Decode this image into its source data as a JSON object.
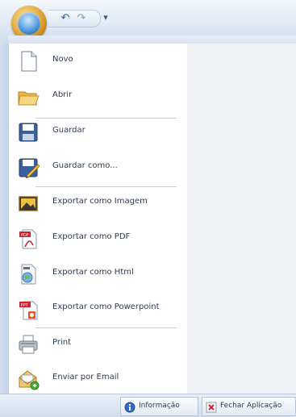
{
  "quick_access": {
    "undo_icon": "undo-icon",
    "redo_icon": "redo-icon",
    "customize_glyph": "▾"
  },
  "menu": {
    "items": [
      {
        "label": "Novo",
        "icon": "new-document-icon"
      },
      {
        "label": "Abrir",
        "icon": "open-folder-icon"
      },
      {
        "label": "Guardar",
        "icon": "save-icon"
      },
      {
        "label": "Guardar como...",
        "icon": "save-as-icon"
      },
      {
        "label": "Exportar como Imagem",
        "icon": "image-export-icon"
      },
      {
        "label": "Exportar como PDF",
        "icon": "pdf-icon"
      },
      {
        "label": "Exportar como Html",
        "icon": "html-icon"
      },
      {
        "label": "Exportar como Powerpoint",
        "icon": "powerpoint-icon"
      },
      {
        "label": "Print",
        "icon": "printer-icon"
      },
      {
        "label": "Enviar por Email",
        "icon": "email-icon"
      }
    ]
  },
  "statusbar": {
    "info_label": "Informação",
    "close_label": "Fechar Aplicação"
  },
  "colors": {
    "accent": "#2f7bc7",
    "pdf_red": "#d4202c"
  }
}
